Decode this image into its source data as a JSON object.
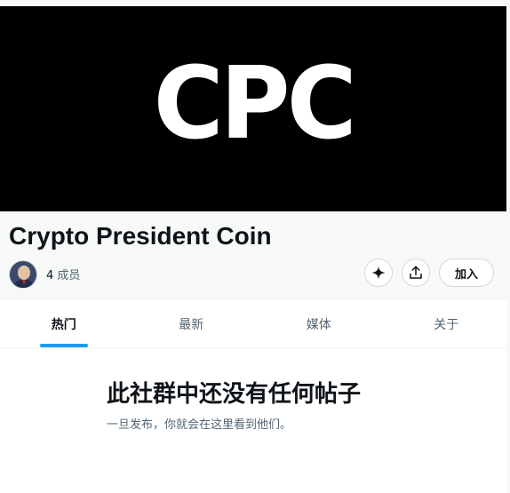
{
  "banner": {
    "logo_text": "CPC",
    "background": "#000000"
  },
  "community": {
    "name": "Crypto President Coin",
    "member_count": "4",
    "member_label": "成员"
  },
  "actions": {
    "sparkle_icon": "sparkle-icon",
    "share_icon": "share-icon",
    "join_label": "加入"
  },
  "tabs": [
    {
      "label": "热门",
      "active": true
    },
    {
      "label": "最新",
      "active": false
    },
    {
      "label": "媒体",
      "active": false
    },
    {
      "label": "关于",
      "active": false
    }
  ],
  "empty_state": {
    "title": "此社群中还没有任何帖子",
    "subtitle": "一旦发布，你就会在这里看到他们。"
  },
  "colors": {
    "accent": "#1d9bf0",
    "text_primary": "#0f1419",
    "text_secondary": "#536471"
  }
}
